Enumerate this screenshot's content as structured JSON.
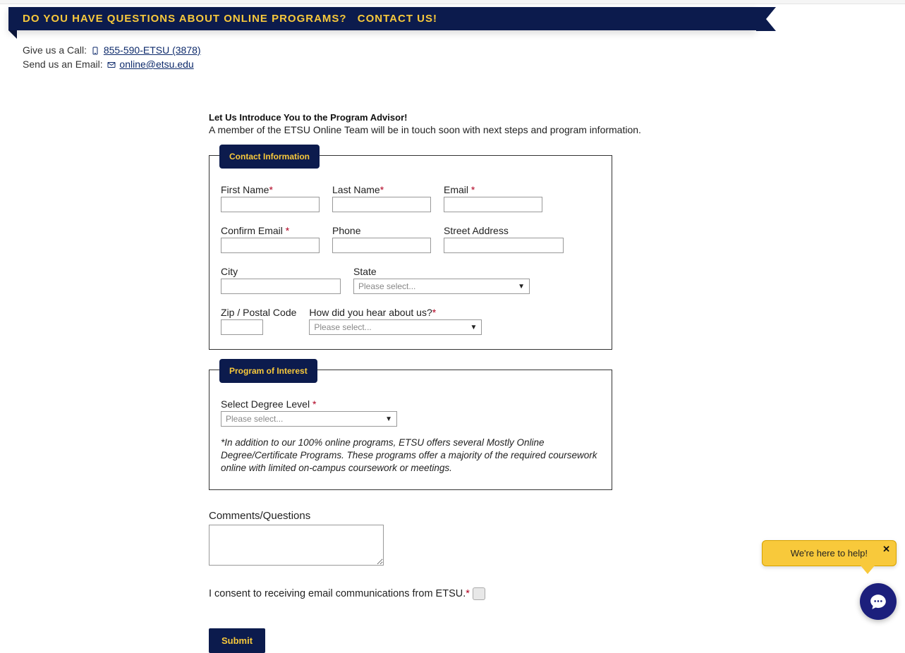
{
  "banner": {
    "question": "DO YOU HAVE QUESTIONS ABOUT ONLINE PROGRAMS?",
    "cta": "CONTACT US!"
  },
  "contact": {
    "call_label": "Give us a Call: ",
    "phone_text": "855-590-ETSU (3878)",
    "email_label": "Send us an Email: ",
    "email_text": "online@etsu.edu"
  },
  "intro": {
    "heading": "Let Us Introduce You to the Program Advisor!",
    "text": "A member of the ETSU Online Team will be in touch soon with next steps and program information."
  },
  "sections": {
    "contact_info_title": "Contact Information",
    "program_interest_title": "Program of Interest"
  },
  "fields": {
    "first_name": "First Name",
    "last_name": "Last Name",
    "email": "Email ",
    "confirm_email": "Confirm Email ",
    "phone": "Phone",
    "street": "Street Address",
    "city": "City",
    "state": "State",
    "zip": "Zip / Postal Code",
    "hear_about": "How did you hear about us?",
    "degree_level": "Select Degree Level  ",
    "please_select": "Please select..."
  },
  "disclosure": "*In addition to our 100% online programs, ETSU offers several Mostly Online Degree/Certificate Programs. These programs offer a majority of the required coursework online with limited on-campus coursework or meetings.",
  "comments_label": "Comments/Questions",
  "consent_text": "I consent to receiving email communications from ETSU.",
  "submit_label": "Submit",
  "chat": {
    "tooltip": "We're here to help!"
  },
  "asterisk": "*"
}
